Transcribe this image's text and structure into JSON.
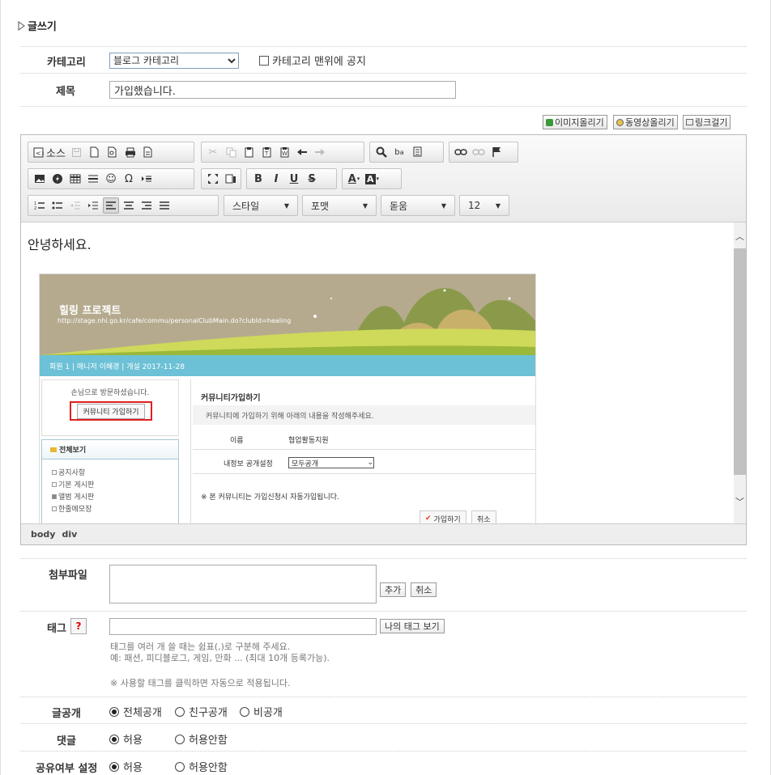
{
  "page_title": "글쓰기",
  "category": {
    "label": "카테고리",
    "selected": "블로그 카테고리",
    "notice_checkbox": "카테고리 맨위에 공지"
  },
  "subject": {
    "label": "제목",
    "value": "가입했습니다."
  },
  "insert_buttons": {
    "image": "이미지올리기",
    "video": "동영상올리기",
    "link": "링크걸기"
  },
  "editor": {
    "source_label": "소스",
    "style_dropdown": "스타일",
    "format_dropdown": "포맷",
    "font_dropdown": "돋움",
    "size_dropdown": "12",
    "body_text": "안녕하세요.",
    "path": [
      "body",
      "div"
    ],
    "bold": "B",
    "italic": "I",
    "underline": "U",
    "strike": "S",
    "text_color": "A",
    "bg_color": "A",
    "omega": "Ω"
  },
  "embedded_screenshot": {
    "banner_title": "힐링 프로젝트",
    "banner_url": "http://stage.nhi.go.kr/cafe/commu/personalClubMain.do?clubId=healing",
    "info_bar": "회원 1 | 매니저 이혜경 | 개설 2017-11-28",
    "visitor_text": "손님으로 방문하셨습니다.",
    "join_button": "커뮤니티 가입하기",
    "all_view": "전체보기",
    "menu": [
      "공지사항",
      "기본 게시판",
      "앨범 게시판",
      "한줄메모장"
    ],
    "join_title": "커뮤니티가입하기",
    "join_note": "커뮤니티에 가입하기 위해 아래의 내용을 작성해주세요.",
    "name_label": "이름",
    "name_value": "협업활동지원",
    "privacy_label": "내정보 공개설정",
    "privacy_value": "모두공개",
    "auto_note": "※ 본 커뮤니티는 가입신청시 자동가입됩니다.",
    "join_submit": "가입하기",
    "cancel": "취소"
  },
  "attach": {
    "label": "첨부파일",
    "add": "추가",
    "cancel": "취소"
  },
  "tag": {
    "label": "태그",
    "help": "?",
    "my_tags": "나의 태그 보기",
    "hint1": "태그를 여러 개 쓸 때는 쉼표(,)로 구분해 주세요.",
    "hint2": "예: 패션, 피디블로그, 게임, 만화 ... (최대 10개 등록가능).",
    "hint3": "※ 사용할 태그를 클릭하면 자동으로 적용됩니다."
  },
  "visibility": {
    "label": "글공개",
    "options": [
      "전체공개",
      "친구공개",
      "비공개"
    ],
    "selected": 0
  },
  "comments": {
    "label": "댓글",
    "options": [
      "허용",
      "허용안함"
    ],
    "selected": 0
  },
  "share": {
    "label": "공유여부 설정",
    "options": [
      "허용",
      "허용안함"
    ],
    "selected": 0
  }
}
